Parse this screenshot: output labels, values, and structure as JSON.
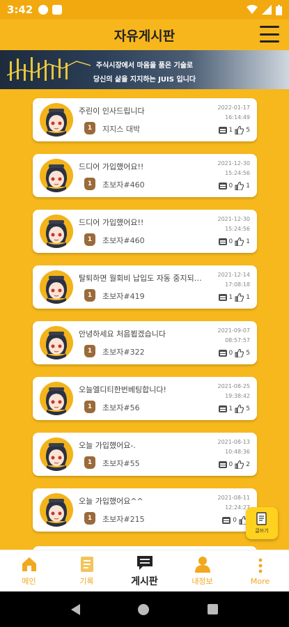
{
  "status_bar": {
    "time": "3:42"
  },
  "header": {
    "title": "자유게시판"
  },
  "banner": {
    "line1": "주식시장에서 마음을 품은 기술로",
    "line2": "당신의 삶을 지지하는 JUIS 입니다"
  },
  "posts": [
    {
      "title": "주린이 인사드립니다",
      "user": "지지스 대박",
      "rank": "1",
      "date": "2022-01-17",
      "time": "16:14:49",
      "comments": "1",
      "likes": "5"
    },
    {
      "title": "드디어 가입했어요!!",
      "user": "초보자#460",
      "rank": "1",
      "date": "2021-12-30",
      "time": "15:24:56",
      "comments": "0",
      "likes": "1"
    },
    {
      "title": "드디어 가입했어요!!",
      "user": "초보자#460",
      "rank": "1",
      "date": "2021-12-30",
      "time": "15:24:56",
      "comments": "0",
      "likes": "1"
    },
    {
      "title": "탈퇴하면 월회비 납입도 자동 중지되나...",
      "user": "초보자#419",
      "rank": "1",
      "date": "2021-12-14",
      "time": "17:08:18",
      "comments": "1",
      "likes": "1"
    },
    {
      "title": "안녕하세요 처음뵙겠습니다",
      "user": "초보자#322",
      "rank": "1",
      "date": "2021-09-07",
      "time": "08:57:57",
      "comments": "0",
      "likes": "5"
    },
    {
      "title": "오늘엘디티한번베팅합니다!",
      "user": "초보자#56",
      "rank": "1",
      "date": "2021-08-25",
      "time": "19:38:42",
      "comments": "1",
      "likes": "5"
    },
    {
      "title": "오늘 가입했어요-.",
      "user": "초보자#55",
      "rank": "1",
      "date": "2021-08-13",
      "time": "10:48:36",
      "comments": "0",
      "likes": "2"
    },
    {
      "title": "오늘 가입했어요^^",
      "user": "초보자#215",
      "rank": "1",
      "date": "2021-08-11",
      "time": "12:24:27",
      "comments": "0",
      "likes": ""
    }
  ],
  "write_button": {
    "label": "글쓰기"
  },
  "bottom_nav": [
    {
      "label": "메인",
      "icon": "home-icon"
    },
    {
      "label": "기록",
      "icon": "record-icon"
    },
    {
      "label": "게시판",
      "icon": "board-icon"
    },
    {
      "label": "내정보",
      "icon": "profile-icon"
    },
    {
      "label": "More",
      "icon": "more-icon"
    }
  ],
  "colors": {
    "accent": "#f6b81c",
    "header": "#f7b71c",
    "nav_label": "#f2a81d"
  }
}
